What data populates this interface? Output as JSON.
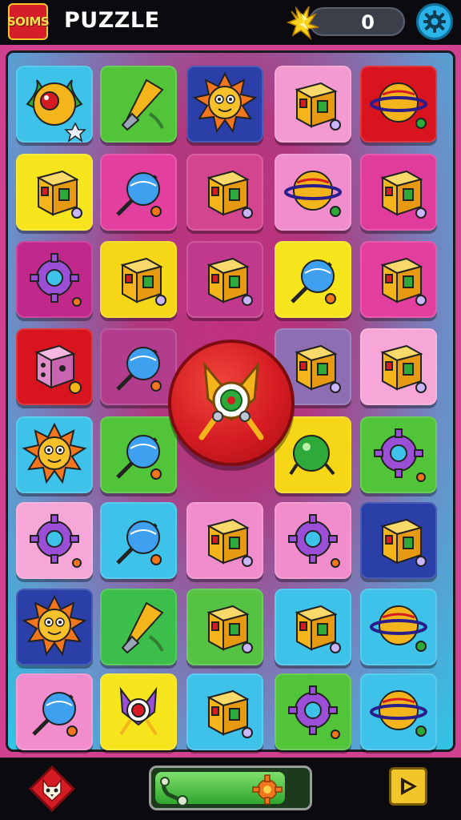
{
  "header": {
    "logo_text": "SOIMS",
    "title": "PUZZLE",
    "score": "0",
    "energy_icon": "lightning-icon",
    "settings_icon": "gear-icon"
  },
  "board": {
    "columns": 5,
    "rows": 8,
    "tiles": [
      {
        "bg": "#3fc2ea",
        "icon": "sun-orb"
      },
      {
        "bg": "#52c43a",
        "icon": "drill"
      },
      {
        "bg": "#2a3fa8",
        "icon": "sun-face"
      },
      {
        "bg": "#f39ad0",
        "icon": "cube"
      },
      {
        "bg": "#d8141f",
        "icon": "planet"
      },
      {
        "bg": "#f6e41c",
        "icon": "cube"
      },
      {
        "bg": "#e23f9e",
        "icon": "orb-wand"
      },
      {
        "bg": "#d3468f",
        "icon": "cube"
      },
      {
        "bg": "#f28dcd",
        "icon": "planet"
      },
      {
        "bg": "#e03c9c",
        "icon": "cube"
      },
      {
        "bg": "#c1288c",
        "icon": "gear"
      },
      {
        "bg": "#f5d718",
        "icon": "cube"
      },
      {
        "bg": "#c1398d",
        "icon": "cube"
      },
      {
        "bg": "#f6e41c",
        "icon": "orb-wand"
      },
      {
        "bg": "#e23f9e",
        "icon": "cube"
      },
      {
        "bg": "#d8141f",
        "icon": "dice"
      },
      {
        "bg": "#b23d8c",
        "icon": "orb-wand"
      },
      null,
      {
        "bg": "#8d6eb2",
        "icon": "cube"
      },
      {
        "bg": "#f6a7d7",
        "icon": "cube"
      },
      {
        "bg": "#3fc2ea",
        "icon": "sun-face"
      },
      {
        "bg": "#52c43a",
        "icon": "orb-wand"
      },
      null,
      {
        "bg": "#f5d718",
        "icon": "orb"
      },
      {
        "bg": "#52c43a",
        "icon": "gear"
      },
      {
        "bg": "#f6a7d7",
        "icon": "gear"
      },
      {
        "bg": "#3fc2ea",
        "icon": "orb-wand"
      },
      {
        "bg": "#f28dcd",
        "icon": "cube"
      },
      {
        "bg": "#f28dcd",
        "icon": "gear"
      },
      {
        "bg": "#2a3fa8",
        "icon": "cube"
      },
      {
        "bg": "#2a3fa8",
        "icon": "sun-face"
      },
      {
        "bg": "#3cbf4a",
        "icon": "drill"
      },
      {
        "bg": "#55c244",
        "icon": "cube"
      },
      {
        "bg": "#3fc2ea",
        "icon": "cube"
      },
      {
        "bg": "#3fc2ea",
        "icon": "planet"
      },
      {
        "bg": "#f28dcd",
        "icon": "orb-wand"
      },
      {
        "bg": "#f6e41c",
        "icon": "fox-target"
      },
      {
        "bg": "#3fc2ea",
        "icon": "cube"
      },
      {
        "bg": "#52c43a",
        "icon": "gear"
      },
      {
        "bg": "#3fc2ea",
        "icon": "planet"
      }
    ],
    "center_button_icon": "fox-target-icon"
  },
  "footer": {
    "left_button_icon": "fox-diamond-icon",
    "progress": 0.86,
    "progress_start_icon": "hook-icon",
    "progress_end_icon": "gear-icon",
    "right_button_icon": "play-arrow-icon"
  }
}
